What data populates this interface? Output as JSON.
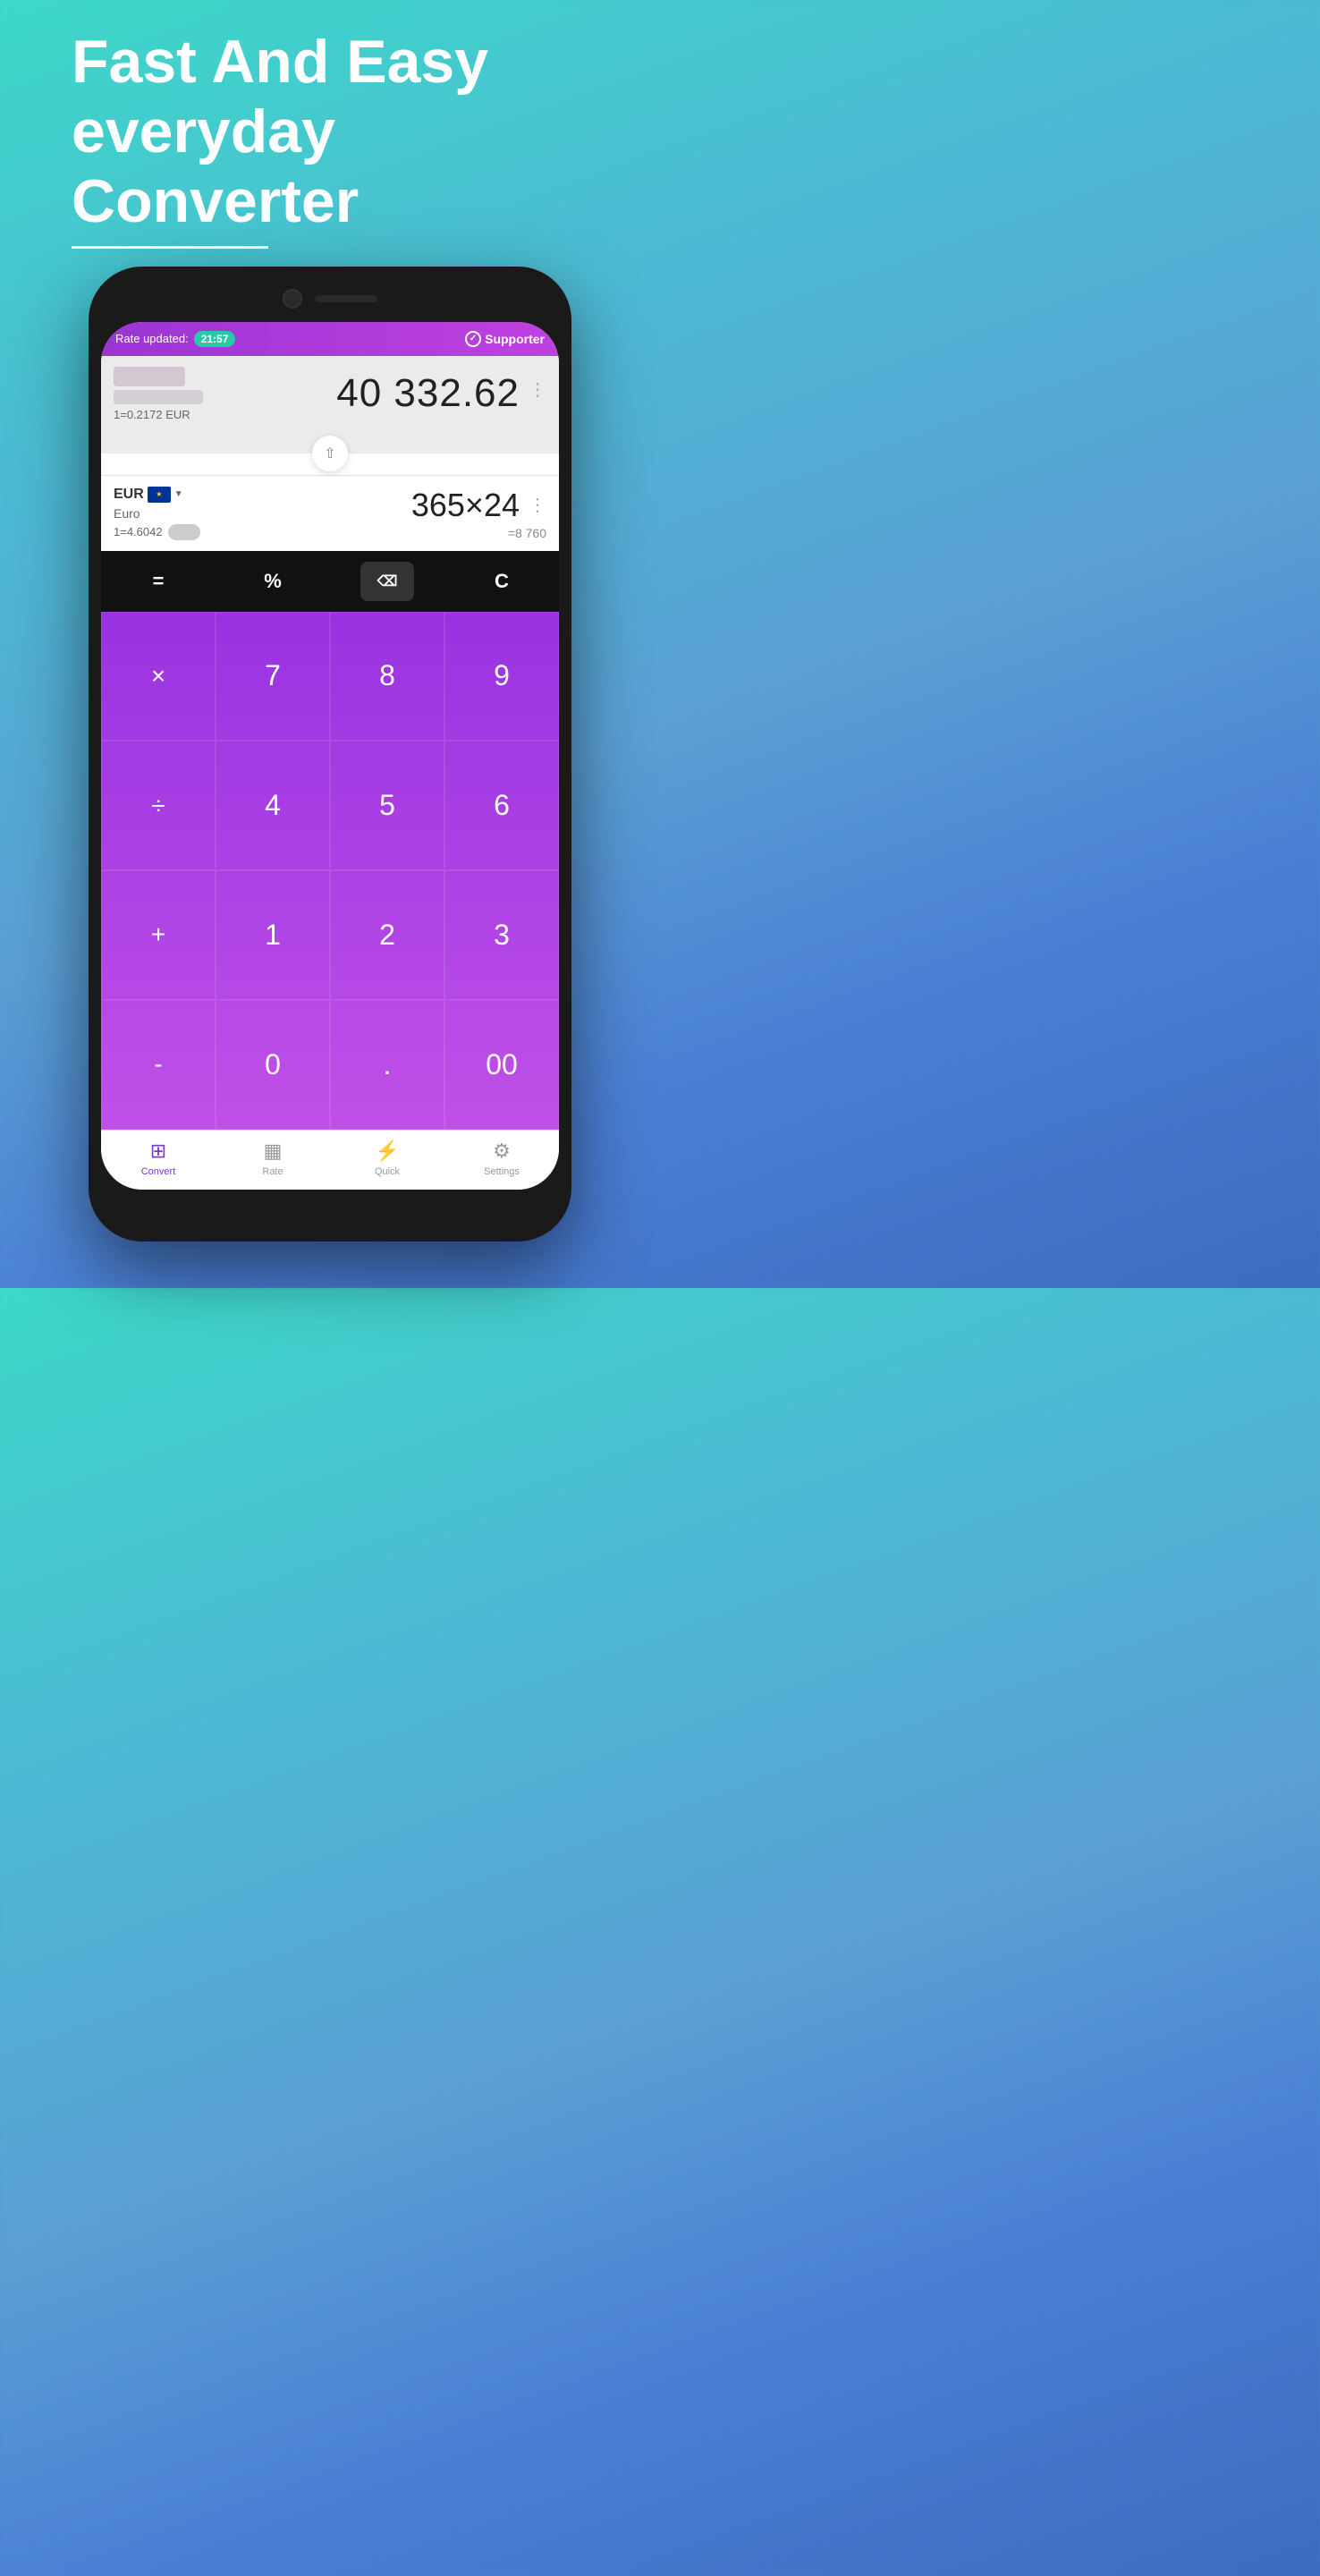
{
  "headline": {
    "line1": "Fast And Easy",
    "line2": "everyday",
    "line3": "Converter"
  },
  "app": {
    "header": {
      "rate_label": "Rate updated:",
      "rate_time": "21:57",
      "supporter_label": "Supporter"
    },
    "top_currency": {
      "amount": "40 332.62",
      "rate": "1=0.2172 EUR"
    },
    "bottom_currency": {
      "code": "EUR",
      "name": "Euro",
      "rate": "1=4.6042",
      "amount": "365×24",
      "result": "=8 760"
    },
    "operators": {
      "equals": "=",
      "percent": "%",
      "backspace": "⌫",
      "clear": "C"
    },
    "numpad": [
      "×",
      "7",
      "8",
      "9",
      "÷",
      "4",
      "5",
      "6",
      "+",
      "1",
      "2",
      "3",
      "-",
      "0",
      ".",
      "00"
    ],
    "nav": {
      "convert": "Convert",
      "rate": "Rate",
      "quick": "Quick",
      "settings": "Settings"
    }
  }
}
